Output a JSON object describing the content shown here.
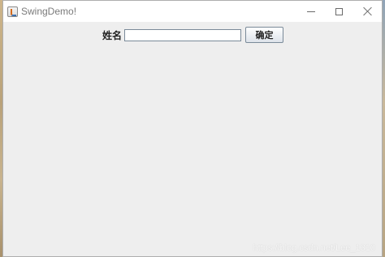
{
  "window": {
    "title": "SwingDemo!"
  },
  "form": {
    "name_label": "姓名",
    "name_value": "",
    "confirm_label": "确定"
  },
  "watermark": {
    "text": "https://blog.csdn.net/Lee_1310"
  },
  "icons": {
    "app": "java-app-icon",
    "minimize": "minimize-icon",
    "maximize": "maximize-icon",
    "close": "close-icon"
  }
}
